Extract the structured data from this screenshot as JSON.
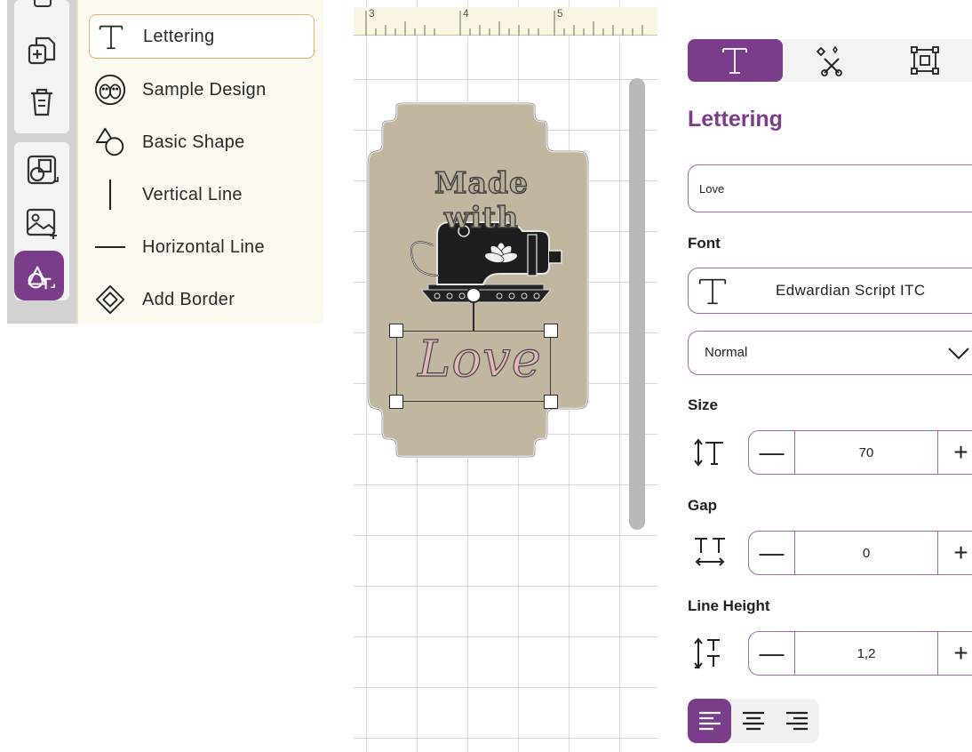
{
  "toolbar": {
    "tools": [
      "copy-icon",
      "duplicate-icon",
      "delete-icon",
      "resize-icon",
      "image-add-icon",
      "add-text-shape-icon"
    ],
    "accent": "#7a3d8a"
  },
  "add_menu": {
    "items": [
      {
        "label": "Lettering",
        "icon": "text-T-icon"
      },
      {
        "label": "Sample Design",
        "icon": "owls-icon"
      },
      {
        "label": "Basic Shape",
        "icon": "shapes-icon"
      },
      {
        "label": "Vertical Line",
        "icon": "vertical-line-icon"
      },
      {
        "label": "Horizontal Line",
        "icon": "horizontal-line-icon"
      },
      {
        "label": "Add Border",
        "icon": "border-icon"
      }
    ],
    "selected": "Lettering",
    "selected_border": "#e3b26a"
  },
  "canvas": {
    "ruler_marks": [
      "3",
      "4",
      "5"
    ],
    "design_text_top": "Made with",
    "design_text_bottom": "Love",
    "label_color": "#c1b6a0"
  },
  "panel": {
    "tabs": [
      "text-tab-icon",
      "magic-wand-tab-icon",
      "transform-tab-icon"
    ],
    "title": "Lettering",
    "text_value": "Love",
    "font_label": "Font",
    "font_name": "Edwardian Script ITC",
    "style_value": "Normal",
    "size_label": "Size",
    "size_value": "70",
    "gap_label": "Gap",
    "gap_value": "0",
    "line_height_label": "Line Height",
    "line_height_value": "1,2",
    "minus_symbol": "—",
    "plus_symbol": "+",
    "alignment": [
      "align-left-icon",
      "align-center-icon",
      "align-right-icon"
    ],
    "alignment_selected": "align-left-icon",
    "accent": "#7a3d8a"
  }
}
